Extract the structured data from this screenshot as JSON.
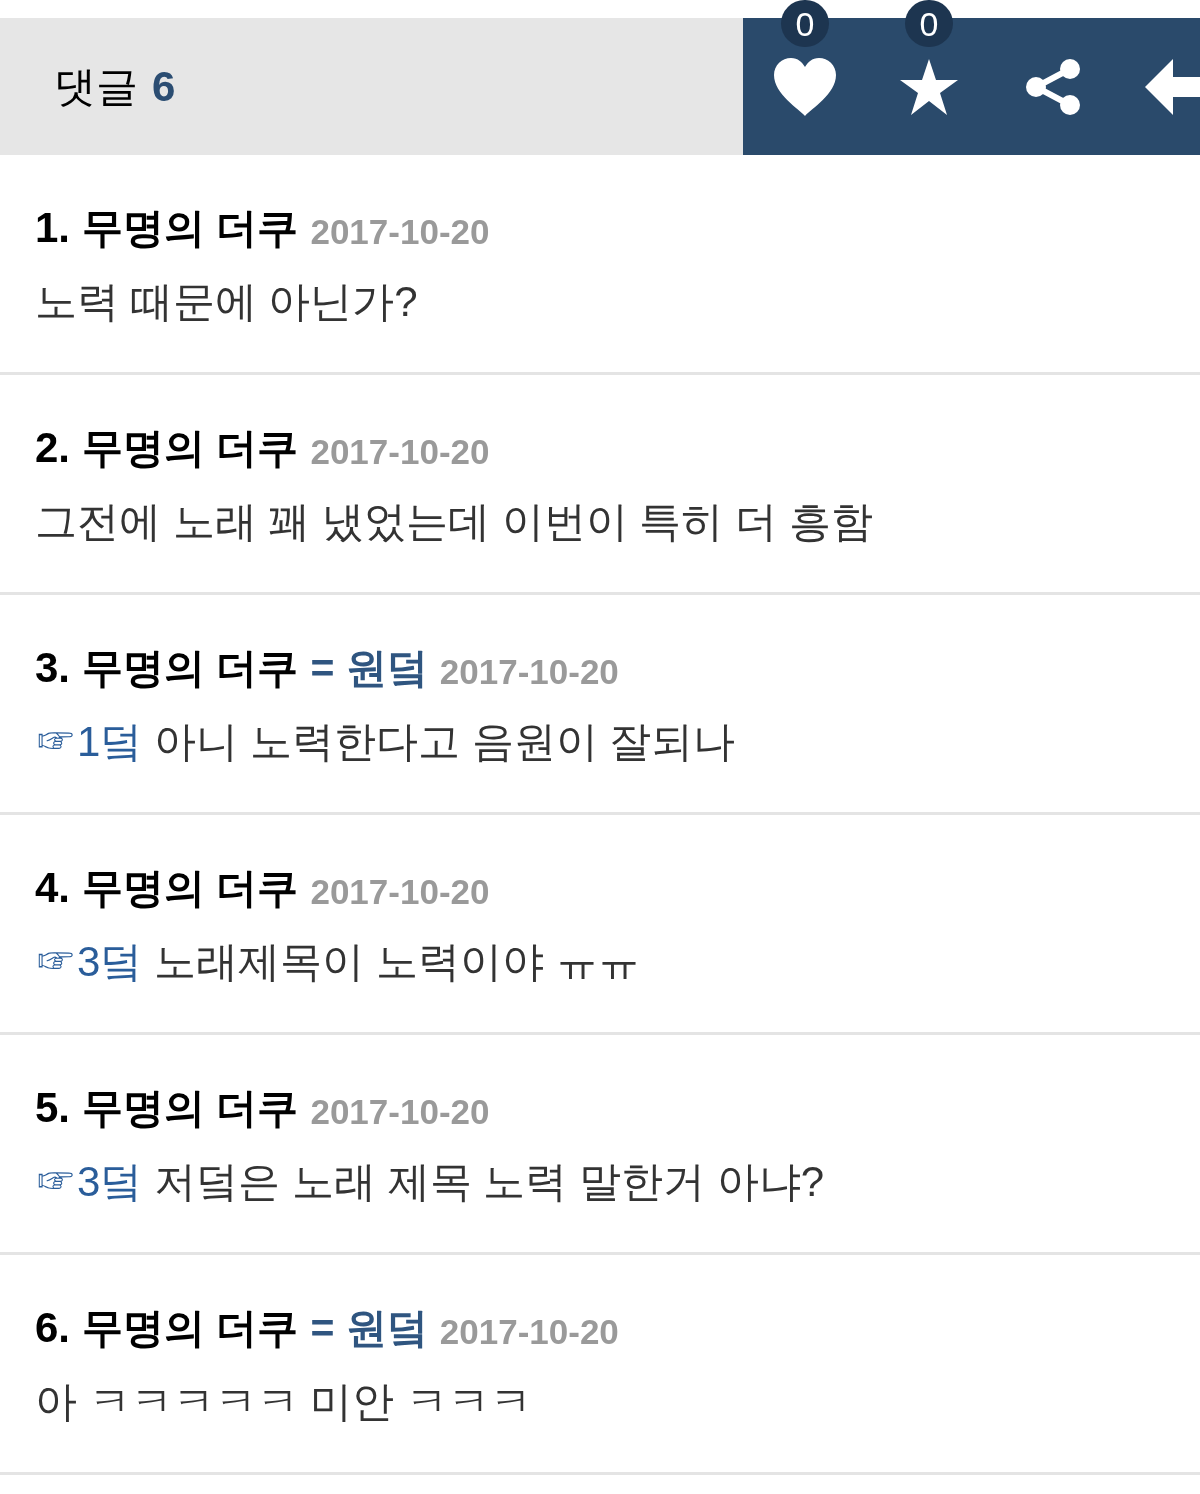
{
  "header": {
    "title": "댓글",
    "count": "6",
    "actions": [
      {
        "kind": "like",
        "count": "0"
      },
      {
        "kind": "star",
        "count": "0"
      },
      {
        "kind": "share"
      },
      {
        "kind": "back"
      }
    ]
  },
  "comments": [
    {
      "number": "1.",
      "author": "무명의 더쿠",
      "date": "2017-10-20",
      "text": "노력 때문에 아닌가?"
    },
    {
      "number": "2.",
      "author": "무명의 더쿠",
      "date": "2017-10-20",
      "text": "그전에 노래 꽤 냈었는데 이번이 특히 더 흥함"
    },
    {
      "number": "3.",
      "author": "무명의 더쿠",
      "op_mark": "= 원덬",
      "date": "2017-10-20",
      "reply_to": "☞1덬",
      "text": "아니 노력한다고 음원이 잘되나"
    },
    {
      "number": "4.",
      "author": "무명의 더쿠",
      "date": "2017-10-20",
      "reply_to": "☞3덬",
      "text": "노래제목이 노력이야 ㅠㅠ"
    },
    {
      "number": "5.",
      "author": "무명의 더쿠",
      "date": "2017-10-20",
      "reply_to": "☞3덬",
      "text": "저덬은 노래 제목 노력 말한거 아냐?"
    },
    {
      "number": "6.",
      "author": "무명의 더쿠",
      "op_mark": "= 원덬",
      "date": "2017-10-20",
      "text": "아 ㅋㅋㅋㅋㅋ 미안 ㅋㅋㅋ"
    }
  ]
}
